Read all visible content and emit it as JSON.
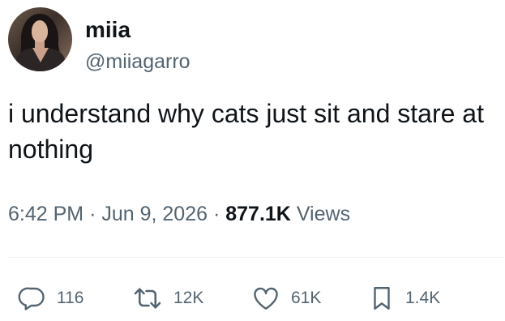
{
  "user": {
    "display_name": "miia",
    "handle": "@miiagarro",
    "avatar_icon": "profile-photo"
  },
  "tweet": {
    "text": "i understand why cats just sit and stare at nothing"
  },
  "meta": {
    "time": "6:42 PM",
    "separator": "·",
    "date": "Jun 9, 2026",
    "views_count": "877.1K",
    "views_label": "Views"
  },
  "actions": {
    "replies": "116",
    "retweets": "12K",
    "likes": "61K",
    "bookmarks": "1.4K"
  },
  "colors": {
    "text_primary": "#0f1419",
    "text_secondary": "#536471",
    "divider": "#eff3f4"
  }
}
